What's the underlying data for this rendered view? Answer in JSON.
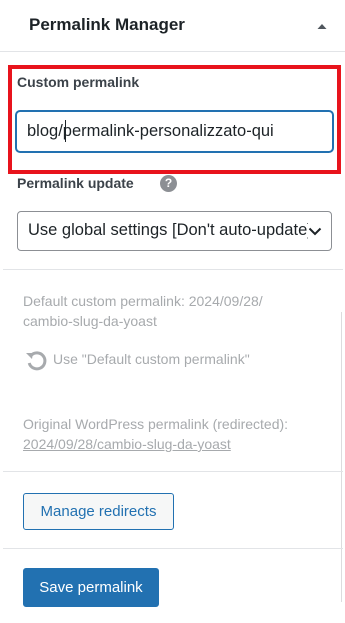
{
  "panel": {
    "title": "Permalink Manager",
    "collapse_icon": "caret-up-icon"
  },
  "custom_permalink": {
    "label": "Custom permalink",
    "value": "blog/permalink-personalizzato-qui"
  },
  "permalink_update": {
    "label": "Permalink update",
    "help_icon": "question-circle-icon",
    "help_glyph": "?",
    "selected": "Use global settings [Don't auto-update]"
  },
  "default_permalink": {
    "label": "Default custom permalink:",
    "value_line1": "2024/09/28/",
    "value_line2": "cambio-slug-da-yoast",
    "use_default_label": "Use \"Default custom permalink\"",
    "use_default_icon": "reset-icon"
  },
  "original_permalink": {
    "label": "Original WordPress permalink (redirected):",
    "value": "2024/09/28/cambio-slug-da-yoast"
  },
  "buttons": {
    "manage_redirects": "Manage redirects",
    "save_permalink": "Save permalink"
  },
  "colors": {
    "accent": "#2271b1",
    "highlight": "#e8131c",
    "muted_text": "#a7aaad"
  }
}
